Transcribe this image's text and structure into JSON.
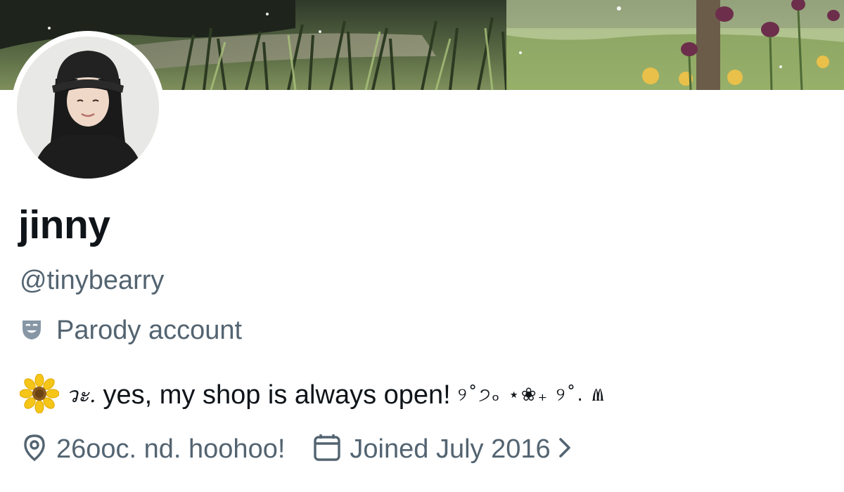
{
  "profile": {
    "display_name": "jinny",
    "handle": "@tinybearry",
    "label": "Parody account",
    "bio": {
      "prefix": "วะ.",
      "text": "yes, my shop is always open!",
      "decoration": "୨˚੭ₒ ⋆❀₊ ୨˚. Ⱞ"
    },
    "location": "26ooc. nd. hoohoo!",
    "joined": "Joined July 2016"
  },
  "icons": {
    "label_icon": "theater-mask-icon",
    "bio_emoji": "sunflower-icon",
    "location_icon": "map-pin-icon",
    "joined_icon": "calendar-icon",
    "joined_chevron": "chevron-right-icon"
  },
  "colors": {
    "primary_text": "#0f1419",
    "secondary_text": "#536471",
    "background": "#ffffff",
    "sunflower": "#f5c518"
  }
}
